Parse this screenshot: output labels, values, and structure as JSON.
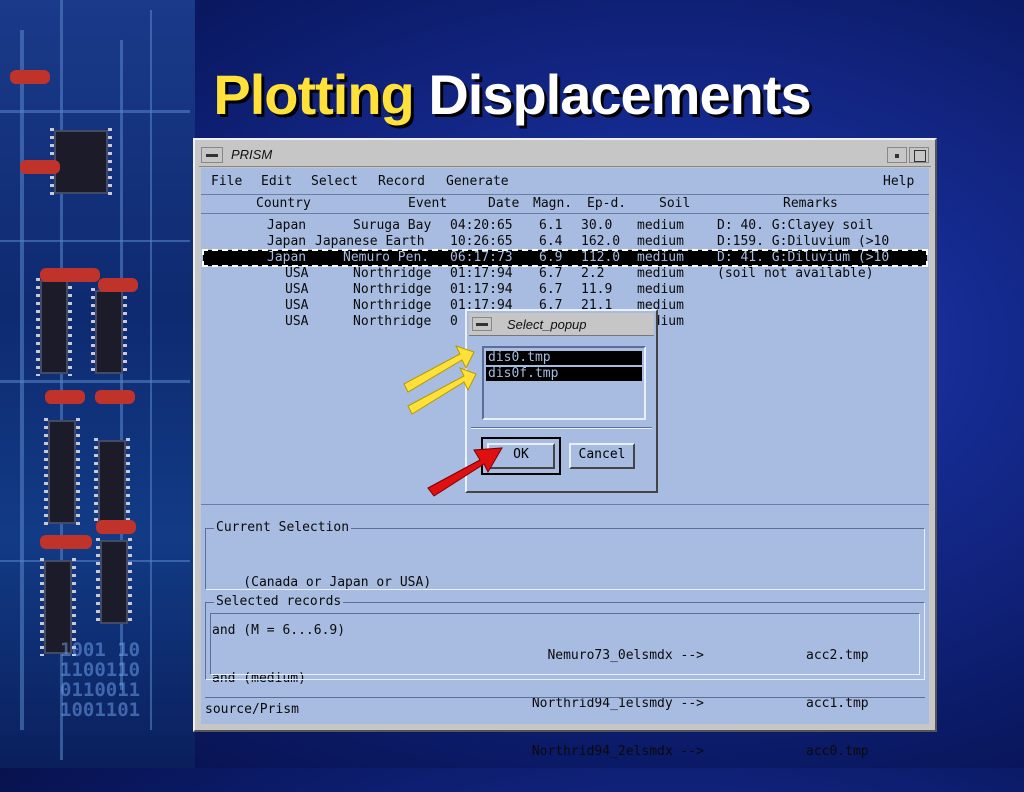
{
  "slide": {
    "title_highlight": "Plotting",
    "title_rest": "Displacements"
  },
  "window": {
    "title": "PRISM",
    "menu": [
      "File",
      "Edit",
      "Select",
      "Record",
      "Generate"
    ],
    "help": "Help",
    "columns": [
      "Country",
      "Event",
      "Date",
      "Magn.",
      "Ep-d.",
      "Soil",
      "Remarks"
    ],
    "rows": [
      {
        "country": "Japan",
        "event": "Suruga Bay",
        "date": "04:20:65",
        "magn": "6.1",
        "epd": "30.0",
        "soil": "medium",
        "remarks": "D: 40. G:Clayey soil",
        "selected": false
      },
      {
        "country": "Japan",
        "event": "Japanese Earth",
        "date": "10:26:65",
        "magn": "6.4",
        "epd": "162.0",
        "soil": "medium",
        "remarks": "D:159. G:Diluvium (>10",
        "selected": false
      },
      {
        "country": "Japan",
        "event": "Nemuro Pen.",
        "date": "06:17:73",
        "magn": "6.9",
        "epd": "112.0",
        "soil": "medium",
        "remarks": "D: 41. G:Diluvium (>10",
        "selected": true
      },
      {
        "country": "USA",
        "event": "Northridge",
        "date": "01:17:94",
        "magn": "6.7",
        "epd": "2.2",
        "soil": "medium",
        "remarks": "(soil not available)",
        "selected": false
      },
      {
        "country": "USA",
        "event": "Northridge",
        "date": "01:17:94",
        "magn": "6.7",
        "epd": "11.9",
        "soil": "medium",
        "remarks": "",
        "selected": false
      },
      {
        "country": "USA",
        "event": "Northridge",
        "date": "01:17:94",
        "magn": "6.7",
        "epd": "21.1",
        "soil": "medium",
        "remarks": "",
        "selected": false
      },
      {
        "country": "USA",
        "event": "Northridge",
        "date": "0",
        "magn": "",
        "epd": "",
        "soil": "medium",
        "remarks": "",
        "selected": false
      }
    ],
    "current_selection": {
      "legend": "Current Selection",
      "lines": [
        "    (Canada or Japan or USA)",
        "and (M = 6...6.9)",
        "and (medium)"
      ]
    },
    "selected_records": {
      "legend": "Selected records",
      "rows": [
        {
          "source": "Nemuro73_0elsmdx -->",
          "target": "acc2.tmp"
        },
        {
          "source": "Northrid94_1elsmdy -->",
          "target": "acc1.tmp"
        },
        {
          "source": "Northrid94_2elsmdx -->",
          "target": "acc0.tmp"
        }
      ]
    },
    "status": "source/Prism"
  },
  "popup": {
    "title": "Select_popup",
    "items": [
      "dis0.tmp",
      "dis0f.tmp"
    ],
    "ok_label": "OK",
    "cancel_label": "Cancel"
  },
  "colors": {
    "title_highlight": "#ffe13a",
    "window_bg": "#a7bce0",
    "arrow_yellow": "#ffe13a",
    "arrow_red": "#e01010"
  }
}
